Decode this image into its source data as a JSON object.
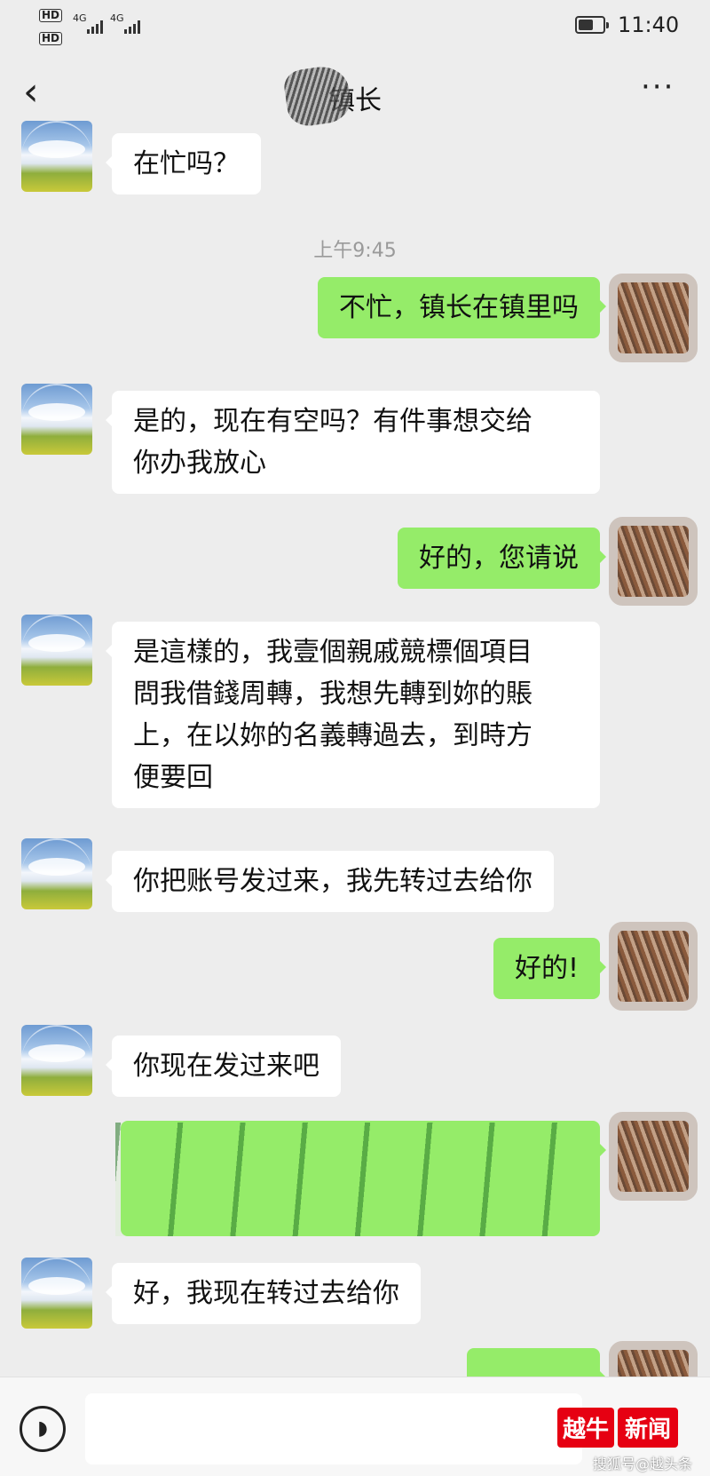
{
  "status_bar": {
    "hd1": "HD",
    "hd2": "HD",
    "net1": "4G",
    "net2": "4G",
    "time": "11:40"
  },
  "nav": {
    "back_icon": "chevron-left-icon",
    "title": "镇长",
    "more": "···"
  },
  "chat": {
    "timestamp": "上午9:45",
    "messages": [
      {
        "from": "other",
        "text": "在忙吗？"
      },
      {
        "from": "self",
        "text": "不忙，镇长在镇里吗"
      },
      {
        "from": "other",
        "lines": [
          "是的，现在有空吗？有件事想交给",
          "你办我放心"
        ]
      },
      {
        "from": "self",
        "text": "好的，您请说"
      },
      {
        "from": "other",
        "lines": [
          "是這樣的，我壹個親戚競標個項目",
          "問我借錢周轉，我想先轉到妳的賬",
          "上，在以妳的名義轉過去，到時方",
          "便要回"
        ]
      },
      {
        "from": "other",
        "text": "你把账号发过来，我先转过去给你"
      },
      {
        "from": "self",
        "text": "好的!"
      },
      {
        "from": "other",
        "text": "你现在发过来吧"
      },
      {
        "from": "self",
        "text": ""
      },
      {
        "from": "other",
        "text": "好，我现在转过去给你"
      },
      {
        "from": "self",
        "text": ""
      }
    ]
  },
  "bottom": {
    "voice_icon": "voice-icon",
    "input_value": ""
  },
  "watermark": {
    "logo": "越牛",
    "news": "新闻",
    "credit": "搜狐号@越头条"
  }
}
